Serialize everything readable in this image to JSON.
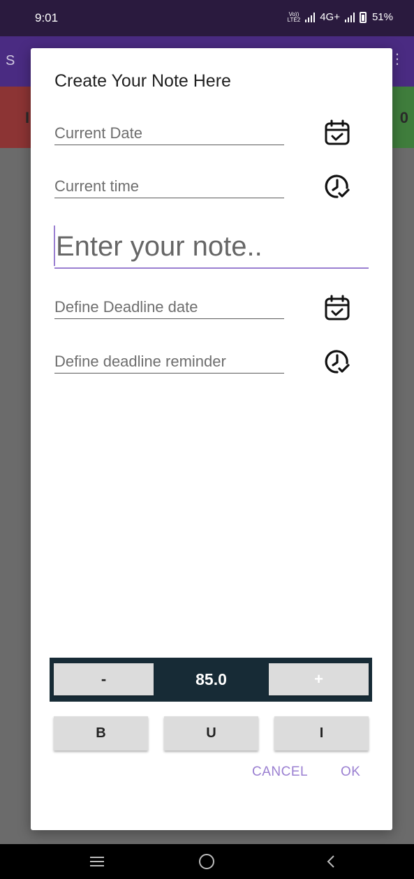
{
  "status_bar": {
    "time": "9:01",
    "network": "4G+",
    "battery": "51%",
    "volte_line1": "Vo))",
    "volte_line2": "LTE2"
  },
  "background_app": {
    "title_initial": "S",
    "left_label": "I",
    "right_label": "0"
  },
  "dialog": {
    "title": "Create Your Note Here",
    "current_date_placeholder": "Current Date",
    "current_time_placeholder": "Current time",
    "note_placeholder": "Enter your note..",
    "deadline_date_placeholder": "Define Deadline date",
    "deadline_reminder_placeholder": "Define deadline reminder",
    "font_size": {
      "minus_label": "-",
      "value": "85.0",
      "plus_label": "+"
    },
    "style_buttons": {
      "bold": "B",
      "underline": "U",
      "italic": "I"
    },
    "cancel_label": "CANCEL",
    "ok_label": "OK"
  },
  "icons": {
    "date_picker": "calendar-check-icon",
    "time_picker": "clock-check-icon",
    "nav_menu": "menu-icon",
    "nav_home": "home-icon",
    "nav_back": "back-icon"
  },
  "colors": {
    "accent": "#9a7fd1",
    "stepper_bg": "#172b36",
    "button_bg": "#dcdcdc",
    "app_bar": "#4a2b82",
    "status_bar": "#2a1a3e"
  }
}
